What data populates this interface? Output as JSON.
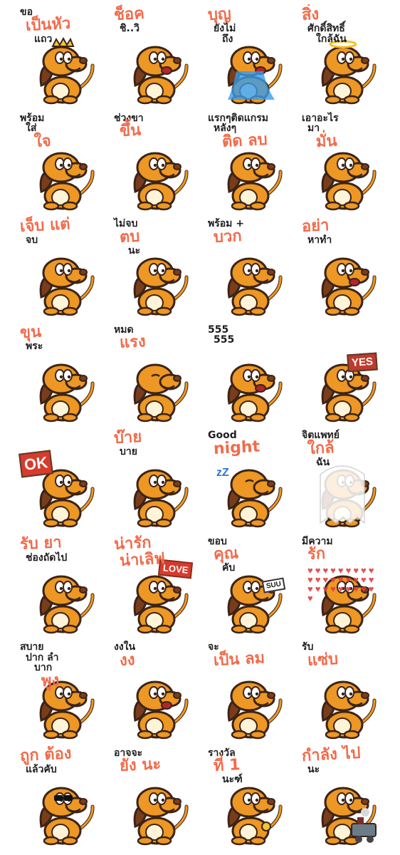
{
  "sticker_sheet": {
    "palette": {
      "background": "#ffffff",
      "accent_text": "#f26b4b",
      "dark_text": "#1f1f1f",
      "dog_body": "#ed9724",
      "dog_outline": "#3b2417",
      "dog_ear": "#7a3d1c",
      "dog_belly": "#fff3d8"
    },
    "stickers": [
      {
        "caption_lines": [
          {
            "text": "ขอ",
            "tone": "dark"
          },
          {
            "text": "เป็นหัว",
            "tone": "accent"
          },
          {
            "text": "แถว",
            "tone": "dark"
          }
        ],
        "art": "crowned-dog"
      },
      {
        "caption_lines": [
          {
            "text": "ช็อค",
            "tone": "accent"
          },
          {
            "text": "ชิ..วิ",
            "tone": "dark"
          }
        ],
        "art": "shocked-dog"
      },
      {
        "caption_lines": [
          {
            "text": "บุญ",
            "tone": "accent"
          },
          {
            "text": "ยังไม่",
            "tone": "dark"
          },
          {
            "text": "ถึง",
            "tone": "dark"
          }
        ],
        "art": "crying-dog"
      },
      {
        "caption_lines": [
          {
            "text": "สิ่ง",
            "tone": "accent"
          },
          {
            "text": "ศักดิ์สิทธิ์",
            "tone": "dark"
          },
          {
            "text": "ใกล้ฉัน",
            "tone": "dark"
          }
        ],
        "art": "halo-dog"
      },
      {
        "caption_lines": [
          {
            "text": "พร้อม",
            "tone": "dark"
          },
          {
            "text": "ใส่",
            "tone": "dark"
          },
          {
            "text": "ใจ",
            "tone": "accent"
          }
        ],
        "art": "peeking-dog"
      },
      {
        "caption_lines": [
          {
            "text": "ช่วงขา",
            "tone": "dark"
          },
          {
            "text": "ขึ้น",
            "tone": "accent"
          }
        ],
        "art": "rolling-dog"
      },
      {
        "caption_lines": [
          {
            "text": "แรกๆติดแกรม",
            "tone": "dark"
          },
          {
            "text": "หลังๆ",
            "tone": "dark"
          },
          {
            "text": "ติด ลบ",
            "tone": "accent"
          }
        ],
        "art": "phone-dog"
      },
      {
        "caption_lines": [
          {
            "text": "เอาอะไร",
            "tone": "dark"
          },
          {
            "text": "มา",
            "tone": "dark"
          },
          {
            "text": "มั่น",
            "tone": "accent"
          }
        ],
        "art": "question-dog"
      },
      {
        "caption_lines": [
          {
            "text": "เจ็บ แต่",
            "tone": "accent"
          },
          {
            "text": "จบ",
            "tone": "dark"
          }
        ],
        "art": "slipping-dog"
      },
      {
        "caption_lines": [
          {
            "text": "ไม่จบ",
            "tone": "dark"
          },
          {
            "text": "ตบ",
            "tone": "accent"
          },
          {
            "text": "นะ",
            "tone": "dark"
          }
        ],
        "art": "angry-dog"
      },
      {
        "caption_lines": [
          {
            "text": "พร้อม +",
            "tone": "dark"
          },
          {
            "text": "บวก",
            "tone": "accent"
          }
        ],
        "art": "flexing-dog"
      },
      {
        "caption_lines": [
          {
            "text": "อย่า",
            "tone": "accent"
          },
          {
            "text": "หาทำ",
            "tone": "dark"
          }
        ],
        "art": "surprised-dog"
      },
      {
        "caption_lines": [
          {
            "text": "ขุน",
            "tone": "accent"
          },
          {
            "text": "พระ",
            "tone": "dark"
          }
        ],
        "art": "spiky-dog"
      },
      {
        "caption_lines": [
          {
            "text": "หมด",
            "tone": "dark"
          },
          {
            "text": "แรง",
            "tone": "accent"
          }
        ],
        "art": "tired-dog"
      },
      {
        "caption_lines": [
          {
            "text": "555",
            "tone": "dark"
          },
          {
            "text": "555",
            "tone": "dark"
          }
        ],
        "art": "laughing-dog"
      },
      {
        "caption_lines": [],
        "sign_text": "YES",
        "art": "yes-sign-dog"
      },
      {
        "caption_lines": [],
        "sign_text": "OK",
        "art": "ok-sign-dog"
      },
      {
        "caption_lines": [
          {
            "text": "บ๊าย",
            "tone": "accent"
          },
          {
            "text": "บาย",
            "tone": "dark"
          }
        ],
        "art": "waving-dog"
      },
      {
        "caption_lines": [
          {
            "text": "Good",
            "tone": "dark"
          },
          {
            "text": "night",
            "tone": "accent"
          }
        ],
        "art": "sleeping-dog"
      },
      {
        "caption_lines": [
          {
            "text": "จิตแพทย์",
            "tone": "dark"
          },
          {
            "text": "ใกล้",
            "tone": "accent"
          },
          {
            "text": "ฉัน",
            "tone": "dark"
          }
        ],
        "art": "ghost-dog"
      },
      {
        "caption_lines": [
          {
            "text": "รับ ยา",
            "tone": "accent"
          },
          {
            "text": "ช่องถัดไป",
            "tone": "dark"
          }
        ],
        "art": "pointing-dog"
      },
      {
        "caption_lines": [
          {
            "text": "น่ารัก",
            "tone": "accent"
          },
          {
            "text": "น่าเลิฟ",
            "tone": "accent"
          }
        ],
        "sign_text": "LOVE",
        "art": "love-sign-dog"
      },
      {
        "caption_lines": [
          {
            "text": "ขอบ",
            "tone": "dark"
          },
          {
            "text": "คุณ",
            "tone": "accent"
          },
          {
            "text": "คับ",
            "tone": "dark"
          }
        ],
        "sign_text": "SUU",
        "art": "thankful-dog"
      },
      {
        "caption_lines": [
          {
            "text": "มีความ",
            "tone": "dark"
          },
          {
            "text": "รัก",
            "tone": "accent"
          }
        ],
        "art": "hearts-dog"
      },
      {
        "caption_lines": [
          {
            "text": "สบาย",
            "tone": "dark"
          },
          {
            "text": "ปาก ลำ",
            "tone": "dark"
          },
          {
            "text": "บาก",
            "tone": "dark"
          },
          {
            "text": "พูง",
            "tone": "accent"
          }
        ],
        "art": "full-dog"
      },
      {
        "caption_lines": [
          {
            "text": "งงใน",
            "tone": "dark"
          },
          {
            "text": "งง",
            "tone": "accent"
          }
        ],
        "art": "dizzy-dog"
      },
      {
        "caption_lines": [
          {
            "text": "จะ",
            "tone": "dark"
          },
          {
            "text": "เป็น ลม",
            "tone": "accent"
          }
        ],
        "art": "fainting-dog"
      },
      {
        "caption_lines": [
          {
            "text": "รับ",
            "tone": "dark"
          },
          {
            "text": "แซ่บ",
            "tone": "accent"
          }
        ],
        "art": "happy-dog"
      },
      {
        "caption_lines": [
          {
            "text": "ถูก ต้อง",
            "tone": "accent"
          },
          {
            "text": "แล้วคับ",
            "tone": "dark"
          }
        ],
        "art": "sunglasses-dog"
      },
      {
        "caption_lines": [
          {
            "text": "อาจจะ",
            "tone": "dark"
          },
          {
            "text": "ยัง นะ",
            "tone": "accent"
          }
        ],
        "art": "phone-call-dog"
      },
      {
        "caption_lines": [
          {
            "text": "รางวัล",
            "tone": "dark"
          },
          {
            "text": "ที่ 1",
            "tone": "accent"
          },
          {
            "text": "นะฑ์",
            "tone": "dark"
          }
        ],
        "art": "winner-dog"
      },
      {
        "caption_lines": [
          {
            "text": "กำลัง ไป",
            "tone": "accent"
          },
          {
            "text": "นะ",
            "tone": "dark"
          }
        ],
        "art": "train-dog"
      }
    ]
  }
}
